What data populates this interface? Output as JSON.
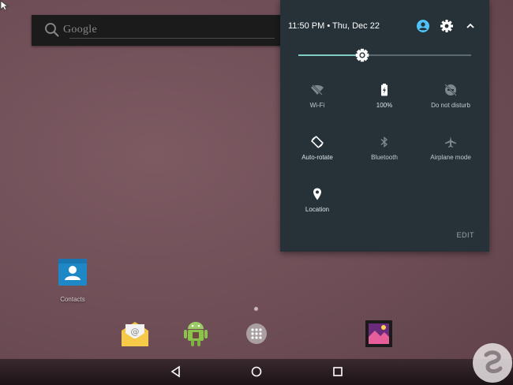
{
  "search": {
    "placeholder": "Google"
  },
  "quick_settings": {
    "header": {
      "time_date": "11:50 PM • Thu, Dec 22"
    },
    "brightness": {
      "level": 0.37
    },
    "tiles": [
      {
        "label": "Wi-Fi",
        "icon": "wifi-off-icon"
      },
      {
        "label": "100%",
        "icon": "battery-charging-icon"
      },
      {
        "label": "Do not disturb",
        "icon": "do-not-disturb-icon"
      },
      {
        "label": "Auto-rotate",
        "icon": "auto-rotate-icon"
      },
      {
        "label": "Bluetooth",
        "icon": "bluetooth-icon"
      },
      {
        "label": "Airplane mode",
        "icon": "airplane-icon"
      },
      {
        "label": "Location",
        "icon": "location-pin-icon"
      }
    ],
    "edit_label": "EDIT"
  },
  "home": {
    "contacts_label": "Contacts"
  },
  "colors": {
    "panel_bg": "#263238",
    "accent": "#80cbc4",
    "account_icon": "#4fc3f7"
  }
}
